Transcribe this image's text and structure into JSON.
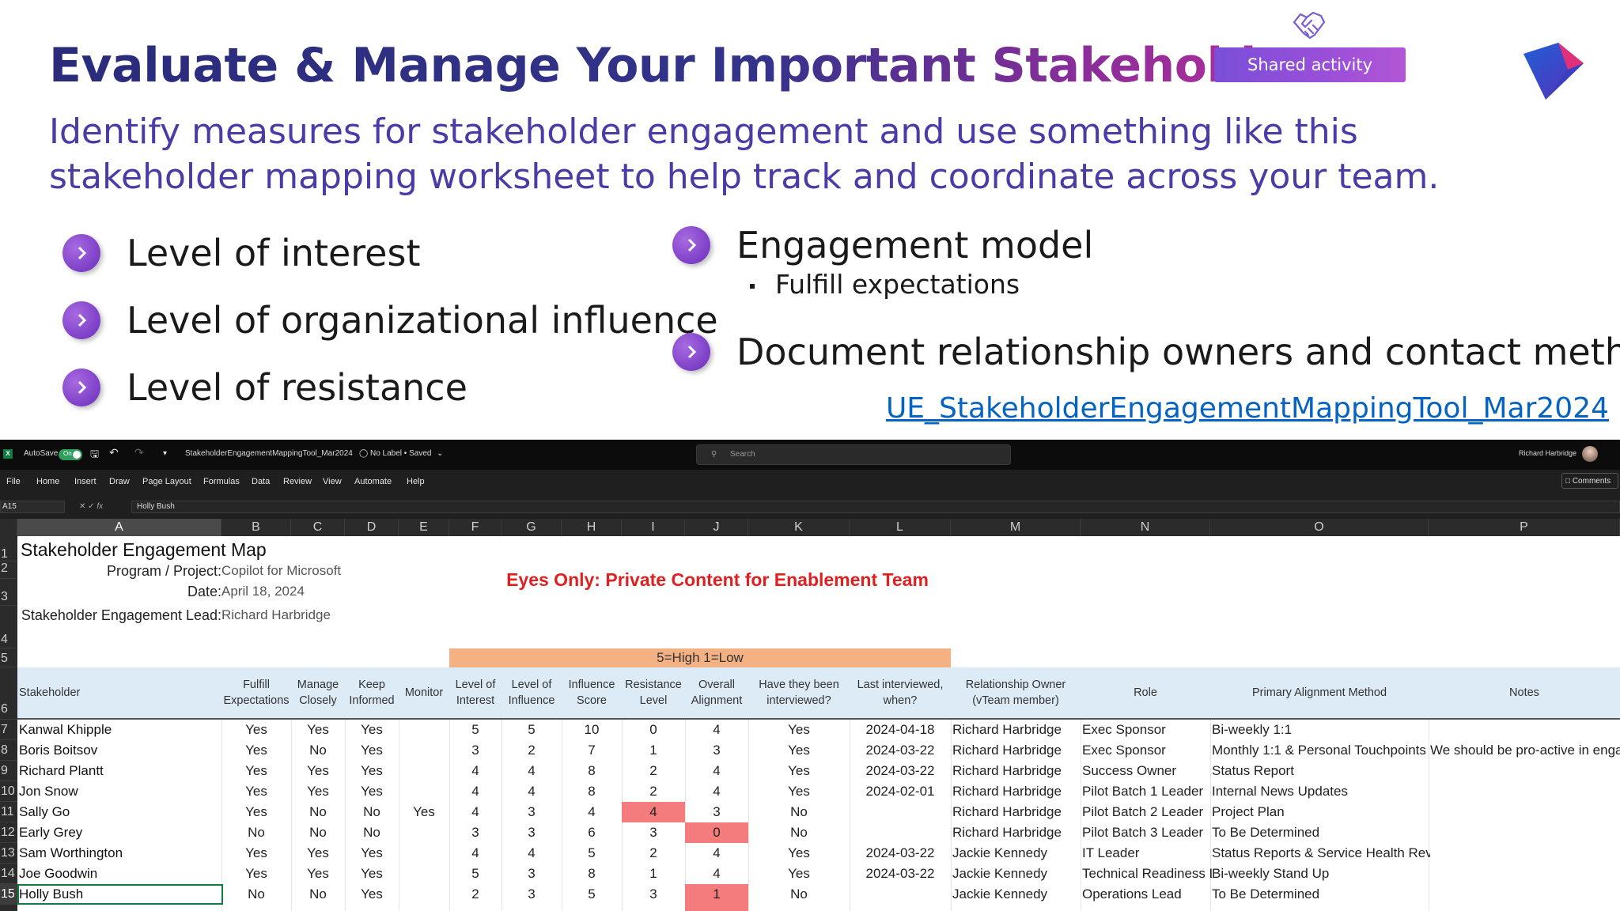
{
  "slide": {
    "title": "Evaluate & Manage Your Important Stakeholders",
    "subtitle": "Identify measures for stakeholder engagement and use something like this stakeholder mapping worksheet to help track and coordinate across your team.",
    "shared_badge": "Shared activity",
    "bullets_left": [
      "Level of interest",
      "Level of organizational influence",
      "Level of resistance"
    ],
    "bullets_right": [
      "Engagement model",
      "Document relationship owners and contact methods"
    ],
    "sub_bullet": "Fulfill expectations",
    "link": "UE_StakeholderEngagementMappingTool_Mar2024",
    "icons": {
      "share": "handshake-icon",
      "logo": "brand-play-logo",
      "bullet": "chevron-right-icon"
    },
    "colors": {
      "title_start": "#2b2b7c",
      "title_end": "#c0309a",
      "subtitle": "#4b3ba6",
      "badge": "#9b4fd8",
      "link": "#0563c1"
    }
  },
  "excel": {
    "app_badge": "X",
    "autosave": "AutoSave",
    "toggle": "On",
    "filename": "StakeholderEngagementMappingTool_Mar2024",
    "label_status": "No Label • Saved",
    "search_placeholder": "Search",
    "user": "Richard Harbridge",
    "menu": [
      "File",
      "Home",
      "Insert",
      "Draw",
      "Page Layout",
      "Formulas",
      "Data",
      "Review",
      "View",
      "Automate",
      "Help"
    ],
    "comments": "Comments",
    "name_box": "A15",
    "formula_value": "Holly Bush",
    "columns": [
      "A",
      "B",
      "C",
      "D",
      "E",
      "F",
      "G",
      "H",
      "I",
      "J",
      "K",
      "L",
      "M",
      "N",
      "O",
      "P"
    ],
    "rows": [
      "1",
      "2",
      "3",
      "4",
      "5",
      "6",
      "7",
      "8",
      "9",
      "10",
      "11",
      "12",
      "13",
      "14",
      "15"
    ],
    "sheet": {
      "title": "Stakeholder Engagement Map",
      "program_label": "Program / Project:",
      "program_value": "Copilot for Microsoft",
      "date_label": "Date:",
      "date_value": "April 18, 2024",
      "lead_label": "Stakeholder Engagement Lead:",
      "lead_value": "Richard Harbridge",
      "eyes_only": "Eyes Only: Private Content for Enablement Team",
      "scale": "5=High 1=Low",
      "headers": [
        "Stakeholder",
        "Fulfill Expectations",
        "Manage Closely",
        "Keep Informed",
        "Monitor",
        "Level of Interest",
        "Level of Influence",
        "Influence Score",
        "Resistance Level",
        "Overall Alignment",
        "Have they been interviewed?",
        "Last interviewed, when?",
        "Relationship Owner (vTeam member)",
        "Role",
        "Primary Alignment Method",
        "Notes"
      ],
      "data": [
        [
          "Kanwal Khipple",
          "Yes",
          "Yes",
          "Yes",
          "",
          "5",
          "5",
          "10",
          "0",
          "4",
          "Yes",
          "2024-04-18",
          "Richard Harbridge",
          "Exec Sponsor",
          "Bi-weekly 1:1",
          ""
        ],
        [
          "Boris Boitsov",
          "Yes",
          "No",
          "Yes",
          "",
          "3",
          "2",
          "7",
          "1",
          "3",
          "Yes",
          "2024-03-22",
          "Richard Harbridge",
          "Exec Sponsor",
          "Monthly 1:1 & Personal Touchpoints",
          "We should be pro-active in engag"
        ],
        [
          "Richard Plantt",
          "Yes",
          "Yes",
          "Yes",
          "",
          "4",
          "4",
          "8",
          "2",
          "4",
          "Yes",
          "2024-03-22",
          "Richard Harbridge",
          "Success Owner",
          "Status Report",
          ""
        ],
        [
          "Jon Snow",
          "Yes",
          "Yes",
          "Yes",
          "",
          "4",
          "4",
          "8",
          "2",
          "4",
          "Yes",
          "2024-02-01",
          "Richard Harbridge",
          "Pilot Batch 1 Leader",
          "Internal News Updates",
          ""
        ],
        [
          "Sally Go",
          "Yes",
          "No",
          "No",
          "Yes",
          "4",
          "3",
          "4",
          "4",
          "3",
          "No",
          "",
          "Richard Harbridge",
          "Pilot Batch 2 Leader",
          "Project Plan",
          ""
        ],
        [
          "Early Grey",
          "No",
          "No",
          "No",
          "",
          "3",
          "3",
          "6",
          "3",
          "0",
          "No",
          "",
          "Richard Harbridge",
          "Pilot Batch 3 Leader",
          "To Be Determined",
          ""
        ],
        [
          "Sam Worthington",
          "Yes",
          "Yes",
          "Yes",
          "",
          "4",
          "4",
          "5",
          "2",
          "4",
          "Yes",
          "2024-03-22",
          "Jackie Kennedy",
          "IT Leader",
          "Status Reports & Service Health Reviews",
          ""
        ],
        [
          "Joe Goodwin",
          "Yes",
          "Yes",
          "Yes",
          "",
          "5",
          "3",
          "8",
          "1",
          "4",
          "Yes",
          "2024-03-22",
          "Jackie Kennedy",
          "Technical Readiness Le",
          "Bi-weekly Stand Up",
          ""
        ],
        [
          "Holly Bush",
          "No",
          "No",
          "Yes",
          "",
          "2",
          "3",
          "5",
          "3",
          "1",
          "No",
          "",
          "Jackie Kennedy",
          "Operations Lead",
          "To Be Determined",
          ""
        ]
      ],
      "highlight_colors": {
        "strong": "#f47c7c",
        "scale_band": "#f4b183",
        "header_band": "#ddebf7",
        "warning_text": "#e02020"
      }
    }
  }
}
